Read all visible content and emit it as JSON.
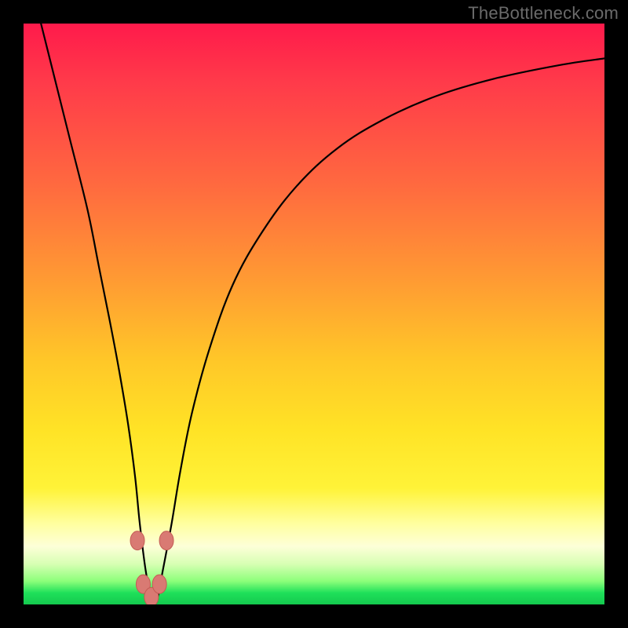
{
  "watermark": {
    "text": "TheBottleneck.com"
  },
  "colors": {
    "background": "#000000",
    "curve": "#000000",
    "marker_fill": "#d97a73",
    "marker_stroke": "#c45b54",
    "gradient_stops": [
      "#ff1a4b",
      "#ff3a4a",
      "#ff6a3f",
      "#ff9a33",
      "#ffc728",
      "#ffe326",
      "#fff338",
      "#ffff9e",
      "#fdffd8",
      "#d8ffb4",
      "#8cff7a",
      "#1fe05a",
      "#14c94e"
    ]
  },
  "chart_data": {
    "type": "line",
    "title": "",
    "xlabel": "",
    "ylabel": "",
    "xlim": [
      0,
      100
    ],
    "ylim": [
      0,
      100
    ],
    "min_x": 22,
    "series": [
      {
        "name": "bottleneck-curve",
        "x": [
          3,
          5,
          8,
          11,
          13,
          15,
          16.5,
          18,
          19.2,
          20,
          21,
          22,
          23,
          24,
          25.5,
          27,
          29,
          32,
          36,
          41,
          47,
          54,
          62,
          71,
          81,
          92,
          100
        ],
        "values": [
          100,
          92,
          80,
          68,
          58,
          48,
          40,
          31,
          22,
          14,
          6,
          1,
          1,
          6,
          14,
          23,
          33,
          44,
          55,
          64,
          72,
          78.5,
          83.5,
          87.5,
          90.5,
          92.8,
          94
        ]
      }
    ],
    "markers": [
      {
        "x": 19.6,
        "y": 11
      },
      {
        "x": 20.6,
        "y": 3.5
      },
      {
        "x": 22.0,
        "y": 1.3
      },
      {
        "x": 23.4,
        "y": 3.5
      },
      {
        "x": 24.6,
        "y": 11
      }
    ]
  }
}
